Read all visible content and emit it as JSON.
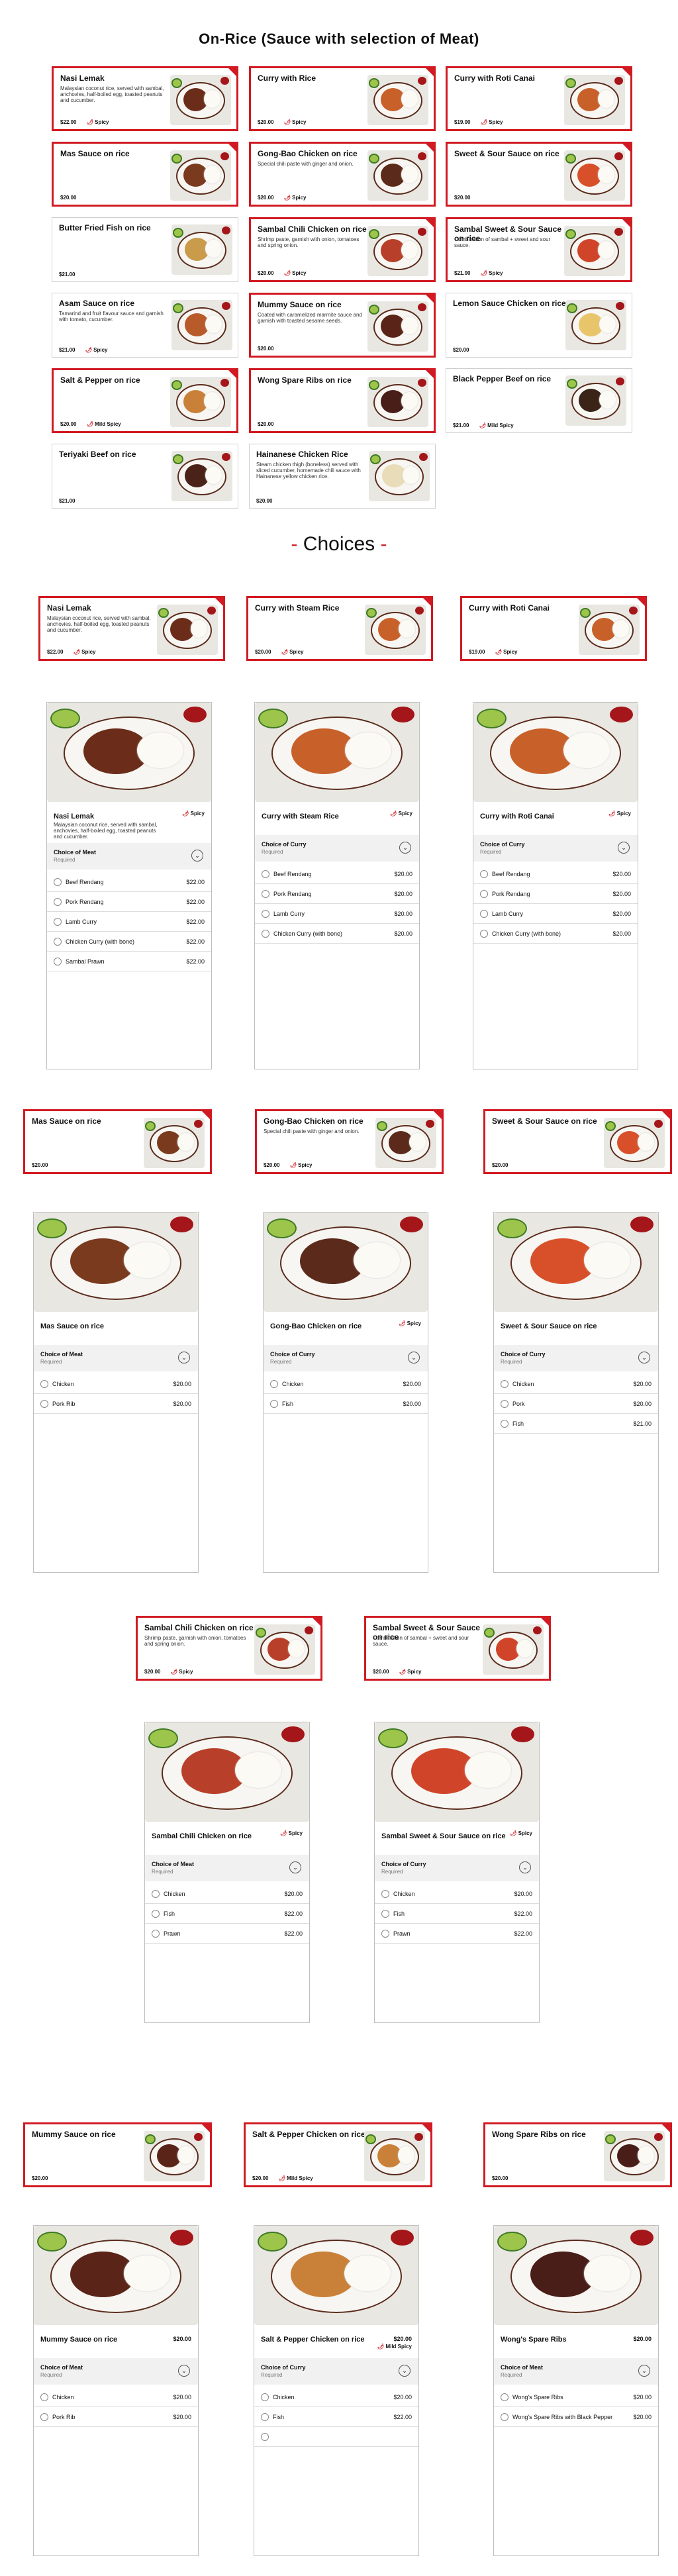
{
  "page_title": "On-Rice (Sauce with selection of Meat)",
  "choices_title": "Choices",
  "choices_dash": "-",
  "spicy_icon": "chili-icon",
  "menu": [
    {
      "title": "Nasi Lemak",
      "desc": "Malaysian coconut rice, served with sambal, anchovies, half-boiled egg, toasted peanuts and cucumber.",
      "price": "$22.00",
      "tag": "Spicy"
    },
    {
      "title": "Curry with Rice",
      "desc": "",
      "price": "$20.00",
      "tag": "Spicy"
    },
    {
      "title": "Curry with Roti Canai",
      "desc": "",
      "price": "$19.00",
      "tag": "Spicy"
    },
    {
      "title": "Mas Sauce on rice",
      "desc": "",
      "price": "$20.00",
      "tag": ""
    },
    {
      "title": "Gong-Bao Chicken on rice",
      "desc": "Special chili paste with ginger and onion.",
      "price": "$20.00",
      "tag": "Spicy"
    },
    {
      "title": "Sweet & Sour Sauce on rice",
      "desc": "",
      "price": "$20.00",
      "tag": ""
    },
    {
      "title": "Butter Fried Fish on rice",
      "desc": "",
      "price": "$21.00",
      "tag": ""
    },
    {
      "title": "Sambal Chili Chicken on rice",
      "desc": "Shrimp paste, garnish with onion, tomatoes and spring onion.",
      "price": "$20.00",
      "tag": "Spicy"
    },
    {
      "title": "Sambal Sweet & Sour Sauce on rice",
      "desc": "Combination of sambal + sweet and sour sauce.",
      "price": "$21.00",
      "tag": "Spicy"
    },
    {
      "title": "Asam Sauce on rice",
      "desc": "Tamarind and fruit flavour sauce and garnish with tomato, cucumber.",
      "price": "$21.00",
      "tag": "Spicy"
    },
    {
      "title": "Mummy Sauce on rice",
      "desc": "Coated with caramelized marmite sauce and garnish with toasted sesame seeds.",
      "price": "$20.00",
      "tag": ""
    },
    {
      "title": "Lemon Sauce Chicken on rice",
      "desc": "",
      "price": "$20.00",
      "tag": ""
    },
    {
      "title": "Salt & Pepper on rice",
      "desc": "",
      "price": "$20.00",
      "tag": "Mild Spicy"
    },
    {
      "title": "Wong Spare Ribs on rice",
      "desc": "",
      "price": "$20.00",
      "tag": ""
    },
    {
      "title": "Black Pepper Beef on rice",
      "desc": "",
      "price": "$21.00",
      "tag": "Mild Spicy"
    },
    {
      "title": "Teriyaki Beef on rice",
      "desc": "",
      "price": "$21.00",
      "tag": ""
    },
    {
      "title": "Hainanese Chicken Rice",
      "desc": "Steam chicken thigh (boneless) served with sliced cucumber, homemade chili sauce with Hainanese yellow chicken rice.",
      "price": "$20.00",
      "tag": ""
    }
  ],
  "cards": {
    "nasi": {
      "title": "Nasi Lemak",
      "desc": "Malaysian coconut rice, served with sambal, anchovies, half-boiled egg, toasted peanuts and cucumber.",
      "price": "$22.00",
      "tag": "Spicy"
    },
    "curry_steam": {
      "title": "Curry with Steam Rice",
      "price": "$20.00",
      "tag": "Spicy"
    },
    "curry_roti": {
      "title": "Curry with Roti Canai",
      "price": "$19.00",
      "tag": "Spicy"
    },
    "mas": {
      "title": "Mas Sauce on rice",
      "price": "$20.00"
    },
    "gongbao": {
      "title": "Gong-Bao Chicken on rice",
      "desc": "Special chili paste with ginger and onion.",
      "price": "$20.00",
      "tag": "Spicy"
    },
    "sweetsour": {
      "title": "Sweet & Sour Sauce on rice",
      "price": "$20.00"
    },
    "sambal": {
      "title": "Sambal Chili Chicken on rice",
      "desc": "Shrimp paste, garnish with onion, tomatoes and spring onion.",
      "price": "$20.00",
      "tag": "Spicy"
    },
    "sambalss": {
      "title": "Sambal Sweet & Sour Sauce on rice",
      "desc": "Combination of sambal + sweet and sour sauce.",
      "price": "$20.00",
      "tag": "Spicy"
    },
    "mummy": {
      "title": "Mummy Sauce on rice",
      "price": "$20.00"
    },
    "saltpepper": {
      "title": "Salt & Pepper Chicken on rice",
      "price": "$20.00",
      "tag": "Mild Spicy"
    },
    "wong": {
      "title": "Wong Spare Ribs on rice",
      "price": "$20.00"
    }
  },
  "details": {
    "nasi": {
      "title": "Nasi Lemak",
      "desc": "Malaysian coconut rice, served with sambal, anchovies, half-boiled egg, toasted peanuts and cucumber.",
      "tag": "Spicy",
      "choice": "Choice of Meat",
      "required": "Required",
      "options": [
        {
          "name": "Beef Rendang",
          "price": "$22.00"
        },
        {
          "name": "Pork Rendang",
          "price": "$22.00"
        },
        {
          "name": "Lamb Curry",
          "price": "$22.00"
        },
        {
          "name": "Chicken Curry (with bone)",
          "price": "$22.00"
        },
        {
          "name": "Sambal Prawn",
          "price": "$22.00"
        }
      ]
    },
    "curry_steam": {
      "title": "Curry with Steam Rice",
      "tag": "Spicy",
      "choice": "Choice of Curry",
      "required": "Required",
      "options": [
        {
          "name": "Beef Rendang",
          "price": "$20.00"
        },
        {
          "name": "Pork Rendang",
          "price": "$20.00"
        },
        {
          "name": "Lamb Curry",
          "price": "$20.00"
        },
        {
          "name": "Chicken Curry (with bone)",
          "price": "$20.00"
        }
      ]
    },
    "curry_roti": {
      "title": "Curry with Roti Canai",
      "tag": "Spicy",
      "choice": "Choice of Curry",
      "required": "Required",
      "options": [
        {
          "name": "Beef Rendang",
          "price": "$20.00"
        },
        {
          "name": "Pork Rendang",
          "price": "$20.00"
        },
        {
          "name": "Lamb Curry",
          "price": "$20.00"
        },
        {
          "name": "Chicken Curry (with bone)",
          "price": "$20.00"
        }
      ]
    },
    "mas": {
      "title": "Mas Sauce on rice",
      "choice": "Choice of Meat",
      "required": "Required",
      "options": [
        {
          "name": "Chicken",
          "price": "$20.00"
        },
        {
          "name": "Pork Rib",
          "price": "$20.00"
        }
      ]
    },
    "gongbao": {
      "title": "Gong-Bao Chicken on rice",
      "tag": "Spicy",
      "choice": "Choice of Curry",
      "required": "Required",
      "options": [
        {
          "name": "Chicken",
          "price": "$20.00"
        },
        {
          "name": "Fish",
          "price": "$20.00"
        }
      ]
    },
    "sweetsour": {
      "title": "Sweet & Sour Sauce on rice",
      "choice": "Choice of Curry",
      "required": "Required",
      "options": [
        {
          "name": "Chicken",
          "price": "$20.00"
        },
        {
          "name": "Pork",
          "price": "$20.00"
        },
        {
          "name": "Fish",
          "price": "$21.00"
        }
      ]
    },
    "sambal": {
      "title": "Sambal Chili Chicken on rice",
      "tag": "Spicy",
      "choice": "Choice of Meat",
      "required": "Required",
      "options": [
        {
          "name": "Chicken",
          "price": "$20.00"
        },
        {
          "name": "Fish",
          "price": "$22.00"
        },
        {
          "name": "Prawn",
          "price": "$22.00"
        }
      ]
    },
    "sambalss": {
      "title": "Sambal Sweet & Sour Sauce on rice",
      "tag": "Spicy",
      "choice": "Choice of Curry",
      "required": "Required",
      "options": [
        {
          "name": "Chicken",
          "price": "$20.00"
        },
        {
          "name": "Fish",
          "price": "$22.00"
        },
        {
          "name": "Prawn",
          "price": "$22.00"
        }
      ]
    },
    "mummy": {
      "title": "Mummy Sauce on rice",
      "price": "$20.00",
      "choice": "Choice of Meat",
      "required": "Required",
      "options": [
        {
          "name": "Chicken",
          "price": "$20.00"
        },
        {
          "name": "Pork Rib",
          "price": "$20.00"
        }
      ]
    },
    "saltpepper": {
      "title": "Salt & Pepper Chicken on rice",
      "price": "$20.00",
      "tag": "Mild Spicy",
      "choice": "Choice of Curry",
      "required": "Required",
      "options": [
        {
          "name": "Chicken",
          "price": "$20.00"
        },
        {
          "name": "Fish",
          "price": "$22.00"
        },
        {
          "name": "",
          "price": ""
        }
      ]
    },
    "wong": {
      "title": "Wong's Spare Ribs",
      "price": "$20.00",
      "choice": "Choice of Meat",
      "required": "Required",
      "options": [
        {
          "name": "Wong's Spare Ribs",
          "price": "$20.00"
        },
        {
          "name": "Wong's Spare Ribs with Black Pepper",
          "price": "$20.00"
        }
      ]
    }
  },
  "colors": {
    "accent": "#d11a22",
    "border_gray": "#cfcfcf",
    "choice_bg": "#f1f1f1"
  }
}
